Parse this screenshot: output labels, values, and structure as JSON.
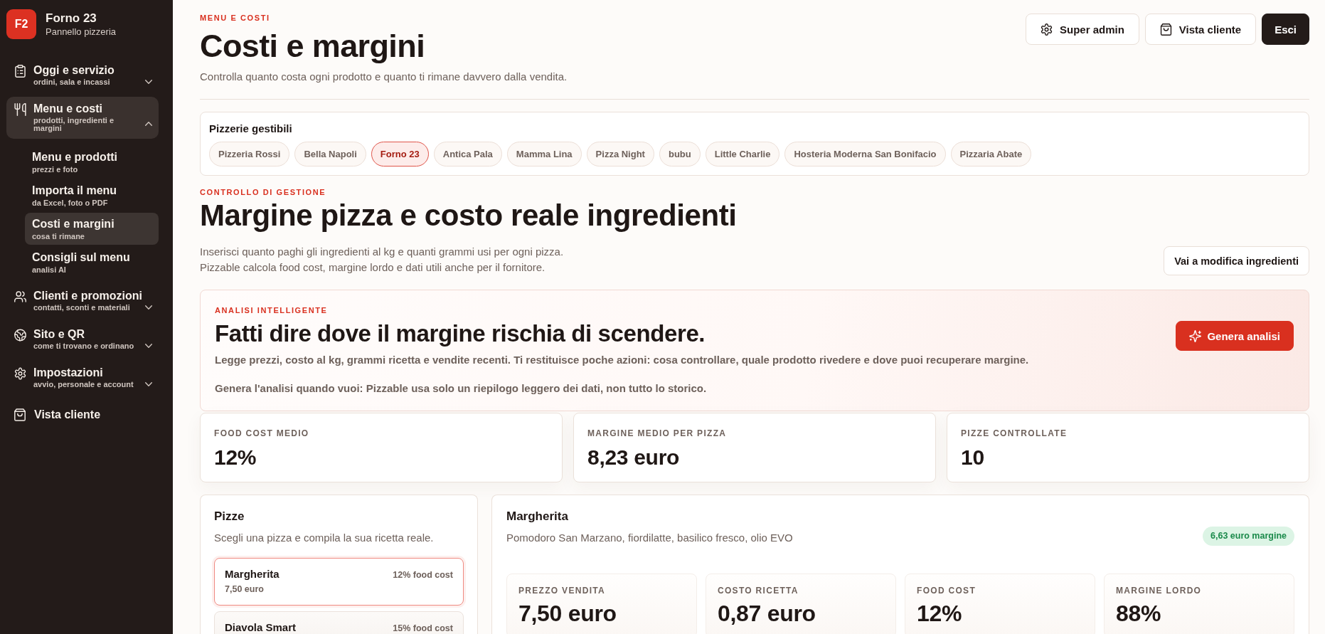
{
  "sidebar": {
    "logo": "F2",
    "title": "Forno 23",
    "subtitle": "Pannello pizzeria",
    "items": [
      {
        "kind": "group",
        "title": "Oggi e servizio",
        "subtitle": "ordini, sala e incassi",
        "selected": false,
        "expanded": false
      },
      {
        "kind": "group",
        "title": "Menu e costi",
        "subtitle": "prodotti, ingredienti e margini",
        "selected": true,
        "expanded": true,
        "children": [
          {
            "title": "Menu e prodotti",
            "subtitle": "prezzi e foto",
            "selected": false
          },
          {
            "title": "Importa il menu",
            "subtitle": "da Excel, foto o PDF",
            "selected": false
          },
          {
            "title": "Costi e margini",
            "subtitle": "cosa ti rimane",
            "selected": true
          },
          {
            "title": "Consigli sul menu",
            "subtitle": "analisi AI",
            "selected": false
          }
        ]
      },
      {
        "kind": "group",
        "title": "Clienti e promozioni",
        "subtitle": "contatti, sconti e materiali",
        "selected": false,
        "expanded": false
      },
      {
        "kind": "group",
        "title": "Sito e QR",
        "subtitle": "come ti trovano e ordinano",
        "selected": false,
        "expanded": false
      },
      {
        "kind": "group",
        "title": "Impostazioni",
        "subtitle": "avvio, personale e account",
        "selected": false,
        "expanded": false
      },
      {
        "kind": "link",
        "title": "Vista cliente",
        "selected": false
      }
    ]
  },
  "header": {
    "eyebrow": "MENU E COSTI",
    "title": "Costi e margini",
    "subtitle": "Controlla quanto costa ogni prodotto e quanto ti rimane davvero dalla vendita.",
    "actions": [
      {
        "kind": "outline",
        "label": "Super admin"
      },
      {
        "kind": "outline",
        "label": "Vista cliente"
      },
      {
        "kind": "dark",
        "label": "Esci"
      }
    ]
  },
  "pizzerie": {
    "title": "Pizzerie gestibili",
    "options": [
      {
        "label": "Pizzeria Rossi",
        "selected": false
      },
      {
        "label": "Bella Napoli",
        "selected": false
      },
      {
        "label": "Forno 23",
        "selected": true
      },
      {
        "label": "Antica Pala",
        "selected": false
      },
      {
        "label": "Mamma Lina",
        "selected": false
      },
      {
        "label": "Pizza Night",
        "selected": false
      },
      {
        "label": "bubu",
        "selected": false
      },
      {
        "label": "Little Charlie",
        "selected": false
      },
      {
        "label": "Hosteria Moderna San Bonifacio",
        "selected": false
      },
      {
        "label": "Pizzaria Abate",
        "selected": false
      }
    ]
  },
  "control": {
    "eyebrow": "CONTROLLO DI GESTIONE",
    "title": "Margine pizza e costo reale ingredienti",
    "lines": [
      "Inserisci quanto paghi gli ingredienti al kg e quanti grammi usi per ogni pizza.",
      "Pizzable calcola food cost, margine lordo e dati utili anche per il fornitore."
    ],
    "button": "Vai a modifica ingredienti"
  },
  "analysis": {
    "eyebrow": "ANALISI INTELLIGENTE",
    "title": "Fatti dire dove il margine rischia di scendere.",
    "description": "Legge prezzi, costo al kg, grammi ricetta e vendite recenti. Ti restituisce poche azioni: cosa controllare, quale prodotto rivedere e dove puoi recuperare margine.",
    "note": "Genera l'analisi quando vuoi: Pizzable usa solo un riepilogo leggero dei dati, non tutto lo storico.",
    "button": "Genera analisi"
  },
  "stats": [
    {
      "label": "FOOD COST MEDIO",
      "value": "12%"
    },
    {
      "label": "MARGINE MEDIO PER PIZZA",
      "value": "8,23 euro"
    },
    {
      "label": "PIZZE CONTROLLATE",
      "value": "10"
    }
  ],
  "pizze": {
    "title": "Pizze",
    "subtitle": "Scegli una pizza e compila la sua ricetta reale.",
    "items": [
      {
        "name": "Margherita",
        "price": "7,50 euro",
        "food_cost": "12% food cost",
        "selected": true
      },
      {
        "name": "Diavola Smart",
        "food_cost": "15% food cost",
        "selected": false
      }
    ]
  },
  "detail": {
    "title": "Margherita",
    "description": "Pomodoro San Marzano, fiordilatte, basilico fresco, olio EVO",
    "badge": "6,63 euro margine",
    "metrics": [
      {
        "label": "PREZZO VENDITA",
        "value": "7,50 euro"
      },
      {
        "label": "COSTO RICETTA",
        "value": "0,87 euro"
      },
      {
        "label": "FOOD COST",
        "value": "12%"
      },
      {
        "label": "MARGINE LORDO",
        "value": "88%"
      }
    ]
  }
}
